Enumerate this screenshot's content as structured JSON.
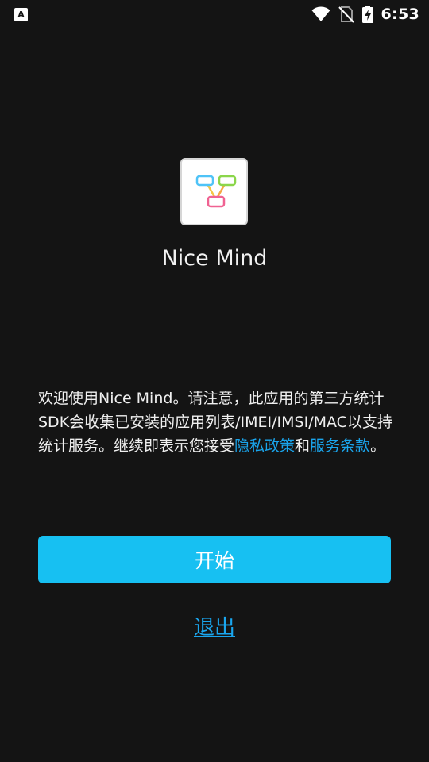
{
  "status_bar": {
    "left_icon": "font-app-icon",
    "left_icon_glyph": "A",
    "icons": [
      "wifi-icon",
      "no-sim-icon",
      "battery-charging-icon"
    ],
    "time": "6:53"
  },
  "app": {
    "name": "Nice Mind",
    "logo_icon": "mind-map-logo-icon"
  },
  "notice": {
    "text_1": "欢迎使用Nice Mind。请注意，此应用的第三方统计SDK会收集已安装的应用列表/IMEI/IMSI/MAC以支持统计服务。继续即表示您接受",
    "privacy_link": "隐私政策",
    "text_2": "和",
    "terms_link": "服务条款",
    "text_3": "。"
  },
  "actions": {
    "start_label": "开始",
    "exit_label": "退出"
  },
  "colors": {
    "background": "#141414",
    "accent": "#17c0f2",
    "link": "#1aa6ee"
  }
}
